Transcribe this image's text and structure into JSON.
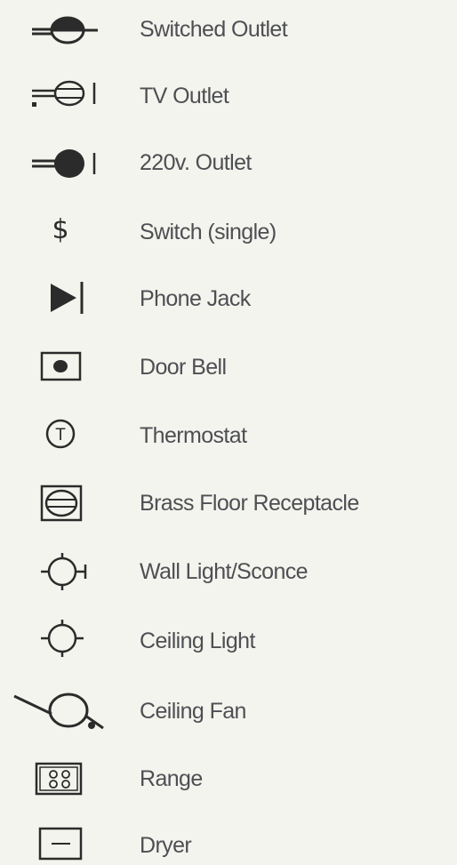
{
  "colors": {
    "background": "#f4f4ee",
    "text": "#4d4f53",
    "symbol": "#2b2b2b"
  },
  "legend": {
    "items": [
      {
        "label": "Switched Outlet",
        "icon": "switched-outlet-icon"
      },
      {
        "label": "TV Outlet",
        "icon": "tv-outlet-icon"
      },
      {
        "label": "220v. Outlet",
        "icon": "outlet-220v-icon"
      },
      {
        "label": "Switch (single)",
        "icon": "switch-single-icon",
        "glyph": "$"
      },
      {
        "label": "Phone Jack",
        "icon": "phone-jack-icon"
      },
      {
        "label": "Door Bell",
        "icon": "door-bell-icon"
      },
      {
        "label": "Thermostat",
        "icon": "thermostat-icon",
        "glyph": "T"
      },
      {
        "label": "Brass Floor Receptacle",
        "icon": "brass-floor-receptacle-icon"
      },
      {
        "label": "Wall Light/Sconce",
        "icon": "wall-light-sconce-icon"
      },
      {
        "label": "Ceiling Light",
        "icon": "ceiling-light-icon"
      },
      {
        "label": "Ceiling Fan",
        "icon": "ceiling-fan-icon"
      },
      {
        "label": "Range",
        "icon": "range-icon"
      },
      {
        "label": "Dryer",
        "icon": "dryer-icon"
      }
    ]
  }
}
